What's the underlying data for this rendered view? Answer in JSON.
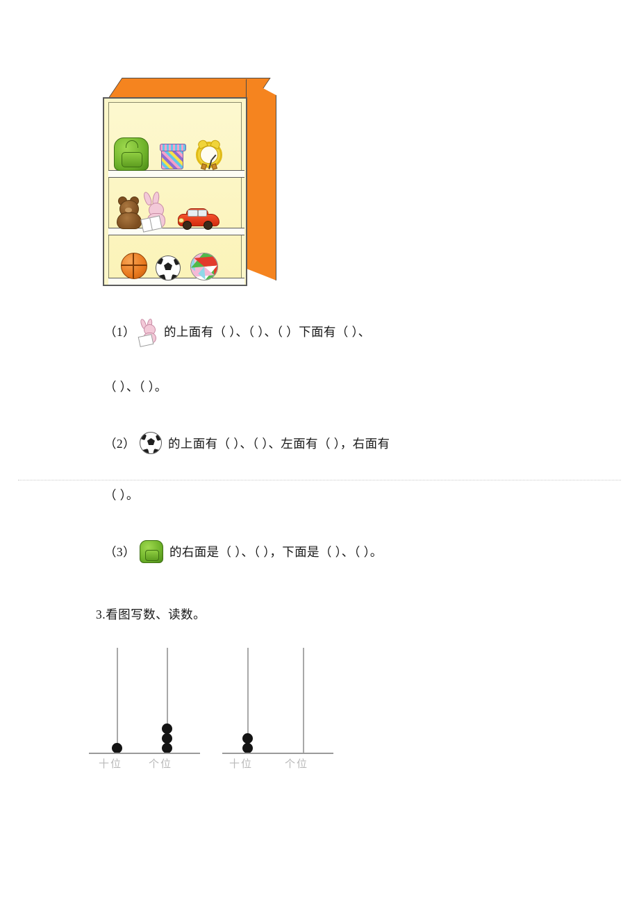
{
  "figure": {
    "name": "toy-shelf-illustration",
    "cabinet": {
      "frame_color": "#f5841f",
      "interior_color": "#fbf6c9",
      "shelf_count": 3
    },
    "shelves": [
      {
        "position": "top",
        "items": [
          "green-backpack",
          "gift-box",
          "alarm-clock"
        ]
      },
      {
        "position": "middle",
        "items": [
          "teddy-bear",
          "rabbit-with-book",
          "red-car"
        ]
      },
      {
        "position": "bottom",
        "items": [
          "basketball",
          "soccer-ball",
          "beach-ball"
        ]
      }
    ]
  },
  "questions": [
    {
      "label": "（1）",
      "icon": "rabbit-with-book-icon",
      "line1": "的上面有（        ）、（        ）、（        ）下面有（        ）、",
      "line2": "（        ）、（        ）。"
    },
    {
      "label": "（2）",
      "icon": "soccer-ball-icon",
      "line1": "的上面有（        ）、（        ）、左面有（        ），右面有",
      "line2": "（        ）。"
    },
    {
      "label": "（3）",
      "icon": "green-backpack-icon",
      "line1": "的右面是（        ）、（        ），下面是（        ）、（        ）。",
      "line2": ""
    }
  ],
  "section3": {
    "heading": "3.看图写数、读数。",
    "abacuses": [
      {
        "name": "abacus-left",
        "tens_label": "十位",
        "ones_label": "个位",
        "tens_beads": 1,
        "ones_beads": 3,
        "value": 13
      },
      {
        "name": "abacus-right",
        "tens_label": "十位",
        "ones_label": "个位",
        "tens_beads": 2,
        "ones_beads": 0,
        "value": 20
      }
    ]
  },
  "chart_data": {
    "type": "table",
    "title": "看图写数、读数。",
    "categories": [
      "十位",
      "个位"
    ],
    "series": [
      {
        "name": "abacus-left",
        "values": [
          1,
          3
        ]
      },
      {
        "name": "abacus-right",
        "values": [
          2,
          0
        ]
      }
    ]
  }
}
